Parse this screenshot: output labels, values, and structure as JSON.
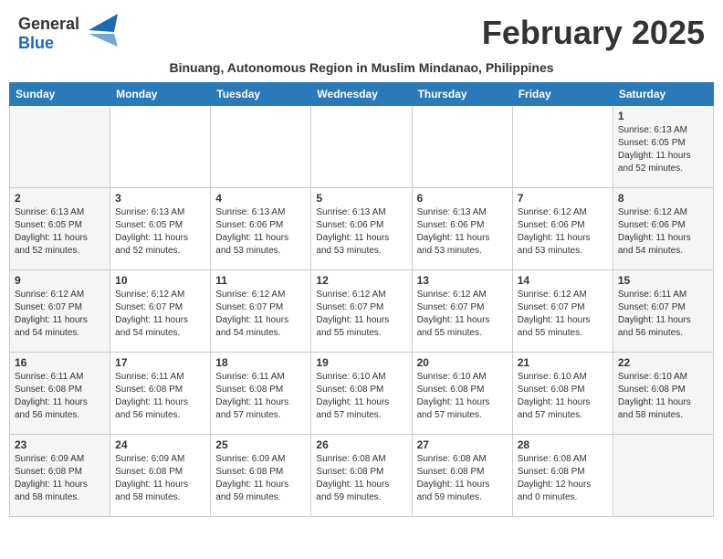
{
  "header": {
    "logo_general": "General",
    "logo_blue": "Blue",
    "month_title": "February 2025",
    "subtitle": "Binuang, Autonomous Region in Muslim Mindanao, Philippines"
  },
  "weekdays": [
    "Sunday",
    "Monday",
    "Tuesday",
    "Wednesday",
    "Thursday",
    "Friday",
    "Saturday"
  ],
  "weeks": [
    [
      {
        "day": "",
        "info": ""
      },
      {
        "day": "",
        "info": ""
      },
      {
        "day": "",
        "info": ""
      },
      {
        "day": "",
        "info": ""
      },
      {
        "day": "",
        "info": ""
      },
      {
        "day": "",
        "info": ""
      },
      {
        "day": "1",
        "info": "Sunrise: 6:13 AM\nSunset: 6:05 PM\nDaylight: 11 hours\nand 52 minutes."
      }
    ],
    [
      {
        "day": "2",
        "info": "Sunrise: 6:13 AM\nSunset: 6:05 PM\nDaylight: 11 hours\nand 52 minutes."
      },
      {
        "day": "3",
        "info": "Sunrise: 6:13 AM\nSunset: 6:05 PM\nDaylight: 11 hours\nand 52 minutes."
      },
      {
        "day": "4",
        "info": "Sunrise: 6:13 AM\nSunset: 6:06 PM\nDaylight: 11 hours\nand 53 minutes."
      },
      {
        "day": "5",
        "info": "Sunrise: 6:13 AM\nSunset: 6:06 PM\nDaylight: 11 hours\nand 53 minutes."
      },
      {
        "day": "6",
        "info": "Sunrise: 6:13 AM\nSunset: 6:06 PM\nDaylight: 11 hours\nand 53 minutes."
      },
      {
        "day": "7",
        "info": "Sunrise: 6:12 AM\nSunset: 6:06 PM\nDaylight: 11 hours\nand 53 minutes."
      },
      {
        "day": "8",
        "info": "Sunrise: 6:12 AM\nSunset: 6:06 PM\nDaylight: 11 hours\nand 54 minutes."
      }
    ],
    [
      {
        "day": "9",
        "info": "Sunrise: 6:12 AM\nSunset: 6:07 PM\nDaylight: 11 hours\nand 54 minutes."
      },
      {
        "day": "10",
        "info": "Sunrise: 6:12 AM\nSunset: 6:07 PM\nDaylight: 11 hours\nand 54 minutes."
      },
      {
        "day": "11",
        "info": "Sunrise: 6:12 AM\nSunset: 6:07 PM\nDaylight: 11 hours\nand 54 minutes."
      },
      {
        "day": "12",
        "info": "Sunrise: 6:12 AM\nSunset: 6:07 PM\nDaylight: 11 hours\nand 55 minutes."
      },
      {
        "day": "13",
        "info": "Sunrise: 6:12 AM\nSunset: 6:07 PM\nDaylight: 11 hours\nand 55 minutes."
      },
      {
        "day": "14",
        "info": "Sunrise: 6:12 AM\nSunset: 6:07 PM\nDaylight: 11 hours\nand 55 minutes."
      },
      {
        "day": "15",
        "info": "Sunrise: 6:11 AM\nSunset: 6:07 PM\nDaylight: 11 hours\nand 56 minutes."
      }
    ],
    [
      {
        "day": "16",
        "info": "Sunrise: 6:11 AM\nSunset: 6:08 PM\nDaylight: 11 hours\nand 56 minutes."
      },
      {
        "day": "17",
        "info": "Sunrise: 6:11 AM\nSunset: 6:08 PM\nDaylight: 11 hours\nand 56 minutes."
      },
      {
        "day": "18",
        "info": "Sunrise: 6:11 AM\nSunset: 6:08 PM\nDaylight: 11 hours\nand 57 minutes."
      },
      {
        "day": "19",
        "info": "Sunrise: 6:10 AM\nSunset: 6:08 PM\nDaylight: 11 hours\nand 57 minutes."
      },
      {
        "day": "20",
        "info": "Sunrise: 6:10 AM\nSunset: 6:08 PM\nDaylight: 11 hours\nand 57 minutes."
      },
      {
        "day": "21",
        "info": "Sunrise: 6:10 AM\nSunset: 6:08 PM\nDaylight: 11 hours\nand 57 minutes."
      },
      {
        "day": "22",
        "info": "Sunrise: 6:10 AM\nSunset: 6:08 PM\nDaylight: 11 hours\nand 58 minutes."
      }
    ],
    [
      {
        "day": "23",
        "info": "Sunrise: 6:09 AM\nSunset: 6:08 PM\nDaylight: 11 hours\nand 58 minutes."
      },
      {
        "day": "24",
        "info": "Sunrise: 6:09 AM\nSunset: 6:08 PM\nDaylight: 11 hours\nand 58 minutes."
      },
      {
        "day": "25",
        "info": "Sunrise: 6:09 AM\nSunset: 6:08 PM\nDaylight: 11 hours\nand 59 minutes."
      },
      {
        "day": "26",
        "info": "Sunrise: 6:08 AM\nSunset: 6:08 PM\nDaylight: 11 hours\nand 59 minutes."
      },
      {
        "day": "27",
        "info": "Sunrise: 6:08 AM\nSunset: 6:08 PM\nDaylight: 11 hours\nand 59 minutes."
      },
      {
        "day": "28",
        "info": "Sunrise: 6:08 AM\nSunset: 6:08 PM\nDaylight: 12 hours\nand 0 minutes."
      },
      {
        "day": "",
        "info": ""
      }
    ]
  ]
}
